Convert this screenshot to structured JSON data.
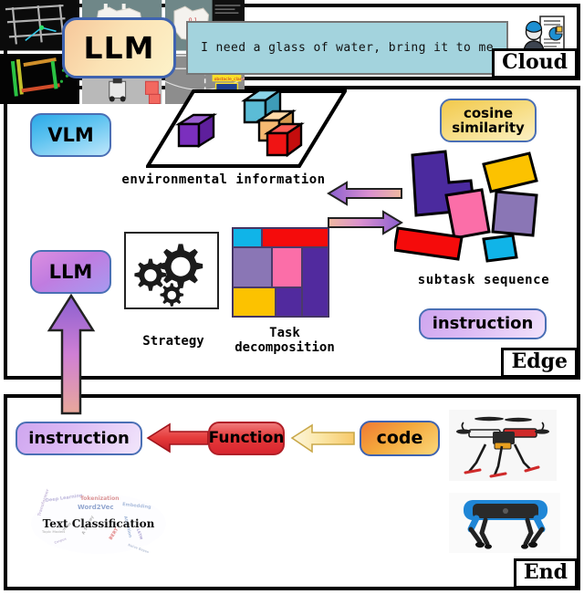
{
  "panels": {
    "cloud": {
      "tag": "Cloud"
    },
    "edge": {
      "tag": "Edge"
    },
    "end": {
      "tag": "End"
    }
  },
  "cloud": {
    "llm_label": "LLM",
    "prompt_text": "I need a glass of water, bring it to me",
    "icon": "user-report-icon"
  },
  "edge": {
    "vlm_label": "VLM",
    "llm_label": "LLM",
    "cosine_line1": "cosine",
    "cosine_line2": "similarity",
    "instruction_label": "instruction",
    "caption_environment": "environmental information",
    "caption_subtask": "subtask sequence",
    "caption_strategy": "Strategy",
    "caption_task_line1": "Task",
    "caption_task_line2": "decomposition",
    "cubes": [
      {
        "name": "purple-cube",
        "color": "#7b2fbe"
      },
      {
        "name": "cyan-cube",
        "color": "#5bbcd6"
      },
      {
        "name": "orange-cube",
        "color": "#f5b971"
      },
      {
        "name": "red-cube",
        "color": "#f01414"
      }
    ],
    "task_decomposition_cells": [
      {
        "name": "cyan-cell",
        "color": "#10b4e8"
      },
      {
        "name": "red-cell",
        "color": "#f50b0b"
      },
      {
        "name": "mauve-cell",
        "color": "#8a76b5"
      },
      {
        "name": "pink-cell",
        "color": "#fb6ea8"
      },
      {
        "name": "indigo-cell",
        "color": "#512a9e"
      },
      {
        "name": "yellow-cell",
        "color": "#fcc200"
      }
    ],
    "subtask_shapes": [
      {
        "name": "indigo-tetromino",
        "color": "#4b2a9e"
      },
      {
        "name": "yellow-block",
        "color": "#fcc200"
      },
      {
        "name": "pink-block",
        "color": "#fb6ea8"
      },
      {
        "name": "mauve-block",
        "color": "#8a76b5"
      },
      {
        "name": "red-bar",
        "color": "#f50b0b"
      },
      {
        "name": "cyan-block",
        "color": "#10b4e8"
      }
    ]
  },
  "end": {
    "instruction_label": "instruction",
    "function_label": "Function",
    "code_label": "code",
    "wordcloud_label": "Text Classification",
    "devices": [
      {
        "name": "drone-photo",
        "label": "quadcopter drone"
      },
      {
        "name": "robot-dog-photo",
        "label": "quadruped robot"
      }
    ],
    "photo_grid": [
      {
        "name": "lidar-slam-map"
      },
      {
        "name": "occupancy-grid-map"
      },
      {
        "name": "occupancy-map-with-terminal"
      },
      {
        "name": "colored-pointcloud-map"
      },
      {
        "name": "robot-overhead-view"
      },
      {
        "name": "road-detection-view"
      }
    ]
  },
  "colors": {
    "panel_border": "#000000",
    "prompt_bg": "#a3d3dd",
    "pill_border": "#4a6fb5",
    "red_arrow": "#e53b3b",
    "yellow_arrow": "#fbe7a8"
  }
}
